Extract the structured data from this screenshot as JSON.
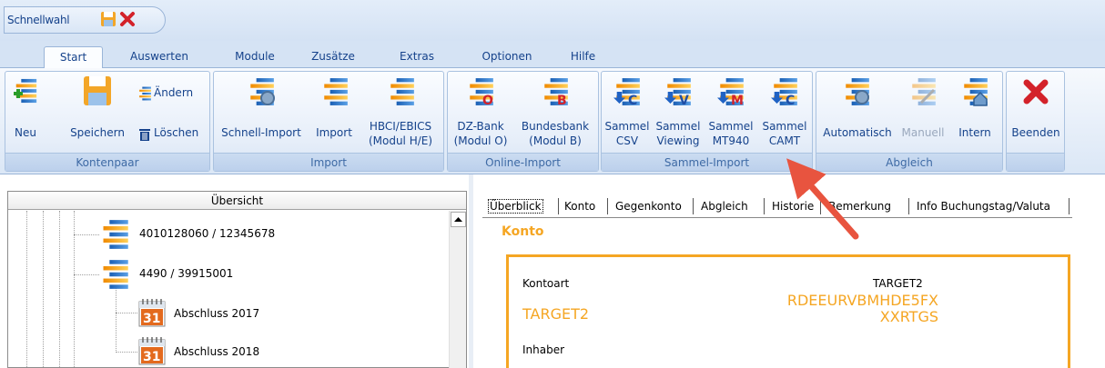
{
  "qat": {
    "title": "Schnellwahl",
    "icons": [
      "save-icon",
      "delete-icon"
    ]
  },
  "tabs": [
    "Start",
    "Auswerten",
    "Module",
    "Zusätze",
    "Extras",
    "Optionen",
    "Hilfe"
  ],
  "ribbon": {
    "kontenpaar": {
      "label": "Kontenpaar",
      "neu": "Neu",
      "speichern": "Speichern",
      "aendern": "Ändern",
      "loeschen": "Löschen"
    },
    "import": {
      "label": "Import",
      "schnell": "Schnell-Import",
      "import": "Import",
      "hbci_1": "HBCI/EBICS",
      "hbci_2": "(Modul H/E)"
    },
    "online": {
      "label": "Online-Import",
      "dz_1": "DZ-Bank",
      "dz_2": "(Modul O)",
      "bb_1": "Bundesbank",
      "bb_2": "(Modul B)"
    },
    "sammel": {
      "label": "Sammel-Import",
      "csv_1": "Sammel",
      "csv_2": "CSV",
      "view_1": "Sammel",
      "view_2": "Viewing",
      "mt_1": "Sammel",
      "mt_2": "MT940",
      "camt_1": "Sammel",
      "camt_2": "CAMT"
    },
    "abgleich": {
      "label": "Abgleich",
      "auto": "Automatisch",
      "manuell": "Manuell",
      "intern": "Intern"
    },
    "beenden": {
      "label": "Beenden"
    }
  },
  "overview": {
    "title": "Übersicht",
    "items": [
      "4010128060 / 12345678",
      "4490 / 39915001",
      "Abschluss 2017",
      "Abschluss 2018"
    ],
    "calendar_day": "31"
  },
  "detail_tabs": [
    "Überblick",
    "Konto",
    "Gegenkonto",
    "Abgleich",
    "Historie",
    "Bemerkung",
    "Info Buchungstag/Valuta"
  ],
  "konto": {
    "heading": "Konto",
    "kontoart_label": "Kontoart",
    "kontoart_value": "TARGET2",
    "kontoart_small": "TARGET2",
    "bic_line1": "RDEEURVBMHDE5FX",
    "bic_line2": "XXRTGS",
    "inhaber_label": "Inhaber"
  },
  "colors": {
    "accent": "#f5a623",
    "ribbon_text": "#15428b",
    "arrow": "#e8543f"
  }
}
